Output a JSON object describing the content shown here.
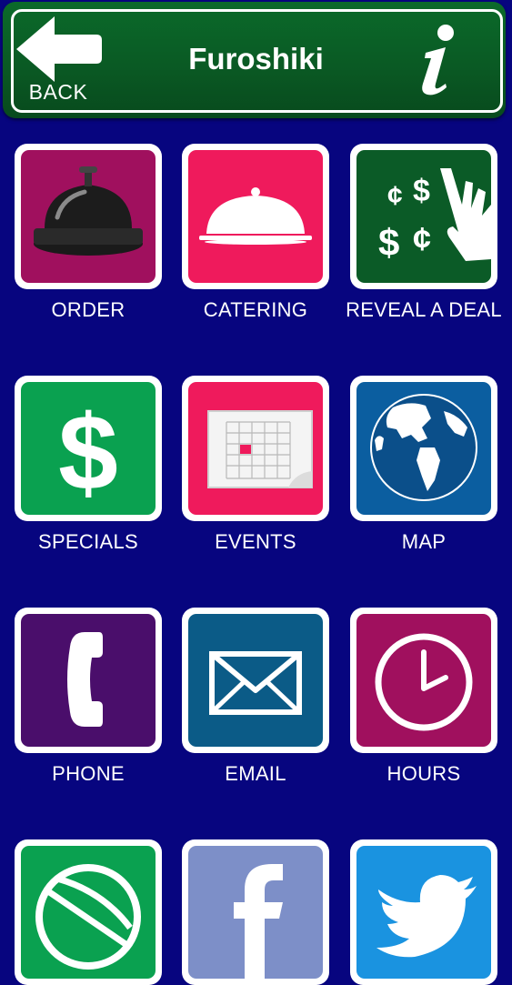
{
  "header": {
    "title": "Furoshiki",
    "back_label": "BACK",
    "info_icon": "info-icon",
    "color": "#0a5a24"
  },
  "tiles": [
    {
      "label": "ORDER",
      "icon": "service-bell-icon",
      "color": "#a0105e"
    },
    {
      "label": "CATERING",
      "icon": "serving-cloche-icon",
      "color": "#ef1a5c"
    },
    {
      "label": "REVEAL A DEAL",
      "icon": "scratch-dollars-icon",
      "color": "#0b5b27"
    },
    {
      "label": "SPECIALS",
      "icon": "dollar-sign-icon",
      "color": "#0aa150"
    },
    {
      "label": "EVENTS",
      "icon": "calendar-icon",
      "color": "#ef1a5c"
    },
    {
      "label": "MAP",
      "icon": "globe-icon",
      "color": "#0b5ea0"
    },
    {
      "label": "PHONE",
      "icon": "phone-icon",
      "color": "#4a0e6b"
    },
    {
      "label": "EMAIL",
      "icon": "envelope-icon",
      "color": "#0b5b87"
    },
    {
      "label": "HOURS",
      "icon": "clock-icon",
      "color": "#a0105e"
    },
    {
      "label": "",
      "icon": "website-globe-icon",
      "color": "#0aa150"
    },
    {
      "label": "",
      "icon": "facebook-icon",
      "color": "#7d8fc8"
    },
    {
      "label": "",
      "icon": "twitter-icon",
      "color": "#1a93e0"
    }
  ]
}
